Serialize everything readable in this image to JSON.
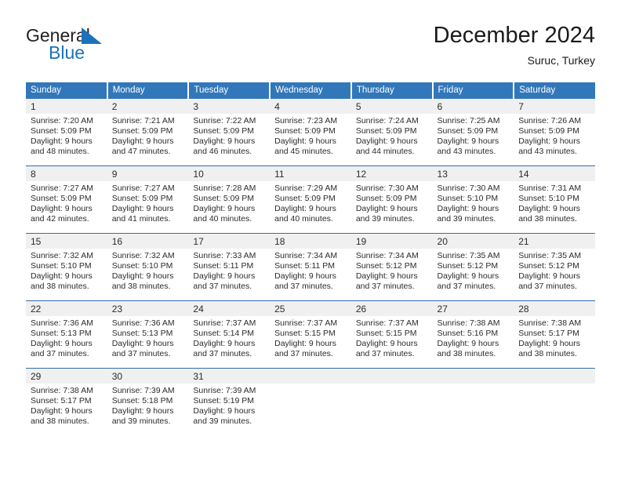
{
  "brand": {
    "name_part1": "General",
    "name_part2": "Blue",
    "mark_icon": "triangle-sail-icon",
    "color_primary": "#1b72b8",
    "color_text": "#231f20"
  },
  "header": {
    "title": "December 2024",
    "subtitle": "Suruc, Turkey"
  },
  "theme": {
    "header_bg": "#3277b9",
    "header_text": "#ffffff",
    "daynum_band_bg": "#f0f0f0",
    "row_divider": "#2f6fae",
    "body_text": "#2b2b2b"
  },
  "weekday_headers": [
    "Sunday",
    "Monday",
    "Tuesday",
    "Wednesday",
    "Thursday",
    "Friday",
    "Saturday"
  ],
  "weeks": [
    [
      {
        "day": "1",
        "sunrise": "Sunrise: 7:20 AM",
        "sunset": "Sunset: 5:09 PM",
        "daylight_line1": "Daylight: 9 hours",
        "daylight_line2": "and 48 minutes."
      },
      {
        "day": "2",
        "sunrise": "Sunrise: 7:21 AM",
        "sunset": "Sunset: 5:09 PM",
        "daylight_line1": "Daylight: 9 hours",
        "daylight_line2": "and 47 minutes."
      },
      {
        "day": "3",
        "sunrise": "Sunrise: 7:22 AM",
        "sunset": "Sunset: 5:09 PM",
        "daylight_line1": "Daylight: 9 hours",
        "daylight_line2": "and 46 minutes."
      },
      {
        "day": "4",
        "sunrise": "Sunrise: 7:23 AM",
        "sunset": "Sunset: 5:09 PM",
        "daylight_line1": "Daylight: 9 hours",
        "daylight_line2": "and 45 minutes."
      },
      {
        "day": "5",
        "sunrise": "Sunrise: 7:24 AM",
        "sunset": "Sunset: 5:09 PM",
        "daylight_line1": "Daylight: 9 hours",
        "daylight_line2": "and 44 minutes."
      },
      {
        "day": "6",
        "sunrise": "Sunrise: 7:25 AM",
        "sunset": "Sunset: 5:09 PM",
        "daylight_line1": "Daylight: 9 hours",
        "daylight_line2": "and 43 minutes."
      },
      {
        "day": "7",
        "sunrise": "Sunrise: 7:26 AM",
        "sunset": "Sunset: 5:09 PM",
        "daylight_line1": "Daylight: 9 hours",
        "daylight_line2": "and 43 minutes."
      }
    ],
    [
      {
        "day": "8",
        "sunrise": "Sunrise: 7:27 AM",
        "sunset": "Sunset: 5:09 PM",
        "daylight_line1": "Daylight: 9 hours",
        "daylight_line2": "and 42 minutes."
      },
      {
        "day": "9",
        "sunrise": "Sunrise: 7:27 AM",
        "sunset": "Sunset: 5:09 PM",
        "daylight_line1": "Daylight: 9 hours",
        "daylight_line2": "and 41 minutes."
      },
      {
        "day": "10",
        "sunrise": "Sunrise: 7:28 AM",
        "sunset": "Sunset: 5:09 PM",
        "daylight_line1": "Daylight: 9 hours",
        "daylight_line2": "and 40 minutes."
      },
      {
        "day": "11",
        "sunrise": "Sunrise: 7:29 AM",
        "sunset": "Sunset: 5:09 PM",
        "daylight_line1": "Daylight: 9 hours",
        "daylight_line2": "and 40 minutes."
      },
      {
        "day": "12",
        "sunrise": "Sunrise: 7:30 AM",
        "sunset": "Sunset: 5:09 PM",
        "daylight_line1": "Daylight: 9 hours",
        "daylight_line2": "and 39 minutes."
      },
      {
        "day": "13",
        "sunrise": "Sunrise: 7:30 AM",
        "sunset": "Sunset: 5:10 PM",
        "daylight_line1": "Daylight: 9 hours",
        "daylight_line2": "and 39 minutes."
      },
      {
        "day": "14",
        "sunrise": "Sunrise: 7:31 AM",
        "sunset": "Sunset: 5:10 PM",
        "daylight_line1": "Daylight: 9 hours",
        "daylight_line2": "and 38 minutes."
      }
    ],
    [
      {
        "day": "15",
        "sunrise": "Sunrise: 7:32 AM",
        "sunset": "Sunset: 5:10 PM",
        "daylight_line1": "Daylight: 9 hours",
        "daylight_line2": "and 38 minutes."
      },
      {
        "day": "16",
        "sunrise": "Sunrise: 7:32 AM",
        "sunset": "Sunset: 5:10 PM",
        "daylight_line1": "Daylight: 9 hours",
        "daylight_line2": "and 38 minutes."
      },
      {
        "day": "17",
        "sunrise": "Sunrise: 7:33 AM",
        "sunset": "Sunset: 5:11 PM",
        "daylight_line1": "Daylight: 9 hours",
        "daylight_line2": "and 37 minutes."
      },
      {
        "day": "18",
        "sunrise": "Sunrise: 7:34 AM",
        "sunset": "Sunset: 5:11 PM",
        "daylight_line1": "Daylight: 9 hours",
        "daylight_line2": "and 37 minutes."
      },
      {
        "day": "19",
        "sunrise": "Sunrise: 7:34 AM",
        "sunset": "Sunset: 5:12 PM",
        "daylight_line1": "Daylight: 9 hours",
        "daylight_line2": "and 37 minutes."
      },
      {
        "day": "20",
        "sunrise": "Sunrise: 7:35 AM",
        "sunset": "Sunset: 5:12 PM",
        "daylight_line1": "Daylight: 9 hours",
        "daylight_line2": "and 37 minutes."
      },
      {
        "day": "21",
        "sunrise": "Sunrise: 7:35 AM",
        "sunset": "Sunset: 5:12 PM",
        "daylight_line1": "Daylight: 9 hours",
        "daylight_line2": "and 37 minutes."
      }
    ],
    [
      {
        "day": "22",
        "sunrise": "Sunrise: 7:36 AM",
        "sunset": "Sunset: 5:13 PM",
        "daylight_line1": "Daylight: 9 hours",
        "daylight_line2": "and 37 minutes."
      },
      {
        "day": "23",
        "sunrise": "Sunrise: 7:36 AM",
        "sunset": "Sunset: 5:13 PM",
        "daylight_line1": "Daylight: 9 hours",
        "daylight_line2": "and 37 minutes."
      },
      {
        "day": "24",
        "sunrise": "Sunrise: 7:37 AM",
        "sunset": "Sunset: 5:14 PM",
        "daylight_line1": "Daylight: 9 hours",
        "daylight_line2": "and 37 minutes."
      },
      {
        "day": "25",
        "sunrise": "Sunrise: 7:37 AM",
        "sunset": "Sunset: 5:15 PM",
        "daylight_line1": "Daylight: 9 hours",
        "daylight_line2": "and 37 minutes."
      },
      {
        "day": "26",
        "sunrise": "Sunrise: 7:37 AM",
        "sunset": "Sunset: 5:15 PM",
        "daylight_line1": "Daylight: 9 hours",
        "daylight_line2": "and 37 minutes."
      },
      {
        "day": "27",
        "sunrise": "Sunrise: 7:38 AM",
        "sunset": "Sunset: 5:16 PM",
        "daylight_line1": "Daylight: 9 hours",
        "daylight_line2": "and 38 minutes."
      },
      {
        "day": "28",
        "sunrise": "Sunrise: 7:38 AM",
        "sunset": "Sunset: 5:17 PM",
        "daylight_line1": "Daylight: 9 hours",
        "daylight_line2": "and 38 minutes."
      }
    ],
    [
      {
        "day": "29",
        "sunrise": "Sunrise: 7:38 AM",
        "sunset": "Sunset: 5:17 PM",
        "daylight_line1": "Daylight: 9 hours",
        "daylight_line2": "and 38 minutes."
      },
      {
        "day": "30",
        "sunrise": "Sunrise: 7:39 AM",
        "sunset": "Sunset: 5:18 PM",
        "daylight_line1": "Daylight: 9 hours",
        "daylight_line2": "and 39 minutes."
      },
      {
        "day": "31",
        "sunrise": "Sunrise: 7:39 AM",
        "sunset": "Sunset: 5:19 PM",
        "daylight_line1": "Daylight: 9 hours",
        "daylight_line2": "and 39 minutes."
      },
      {
        "day": "",
        "sunrise": "",
        "sunset": "",
        "daylight_line1": "",
        "daylight_line2": ""
      },
      {
        "day": "",
        "sunrise": "",
        "sunset": "",
        "daylight_line1": "",
        "daylight_line2": ""
      },
      {
        "day": "",
        "sunrise": "",
        "sunset": "",
        "daylight_line1": "",
        "daylight_line2": ""
      },
      {
        "day": "",
        "sunrise": "",
        "sunset": "",
        "daylight_line1": "",
        "daylight_line2": ""
      }
    ]
  ]
}
